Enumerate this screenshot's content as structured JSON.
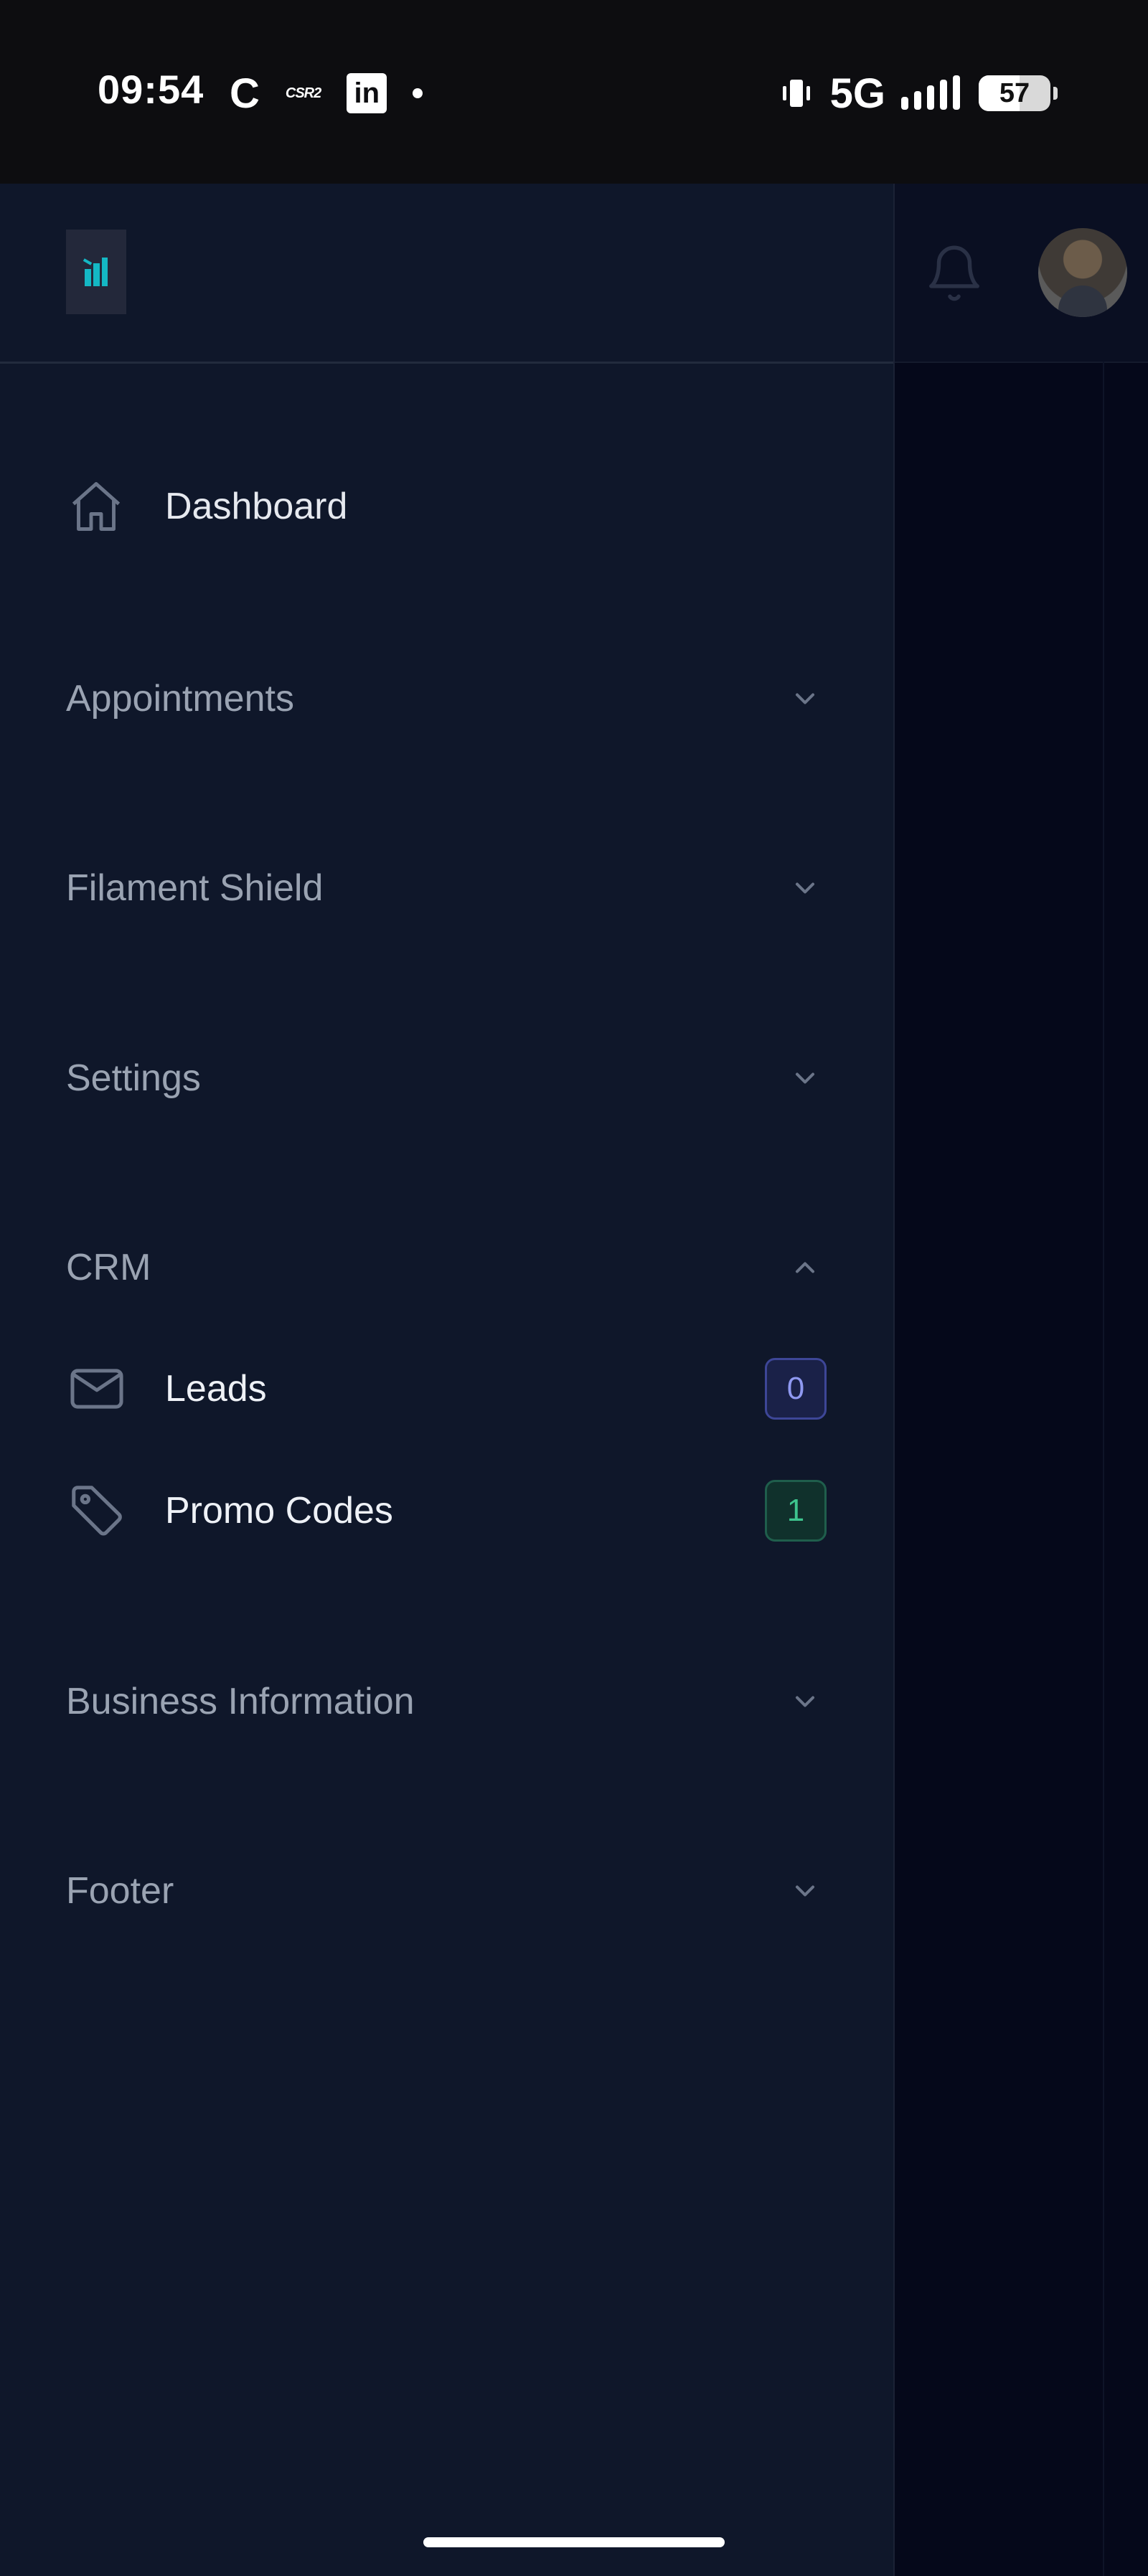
{
  "status_bar": {
    "time": "09:54",
    "app_icons": [
      "c-icon",
      "csr2-icon",
      "linkedin-icon"
    ],
    "csr_label": "CSR2",
    "linkedin_label": "in",
    "c_label": "C",
    "network": "5G",
    "battery_percent": "57",
    "battery_level": 0.57
  },
  "drawer": {
    "logo_icon": "brand-logo-icon",
    "dashboard": {
      "label": "Dashboard",
      "icon": "home-icon"
    },
    "groups": [
      {
        "label": "Appointments",
        "expanded": false
      },
      {
        "label": "Filament Shield",
        "expanded": false
      },
      {
        "label": "Settings",
        "expanded": false
      },
      {
        "label": "CRM",
        "expanded": true,
        "items": [
          {
            "label": "Leads",
            "icon": "envelope-icon",
            "badge": "0",
            "badge_color": "#8f99f1"
          },
          {
            "label": "Promo Codes",
            "icon": "tag-icon",
            "badge": "1",
            "badge_color": "#3ec48e"
          }
        ]
      },
      {
        "label": "Business Information",
        "expanded": false
      },
      {
        "label": "Footer",
        "expanded": false
      }
    ]
  },
  "topbar": {
    "notification_icon": "bell-icon",
    "avatar": "user-avatar"
  },
  "colors": {
    "drawer_bg": "#0f172a",
    "accent_logo": "#14b8c4"
  }
}
